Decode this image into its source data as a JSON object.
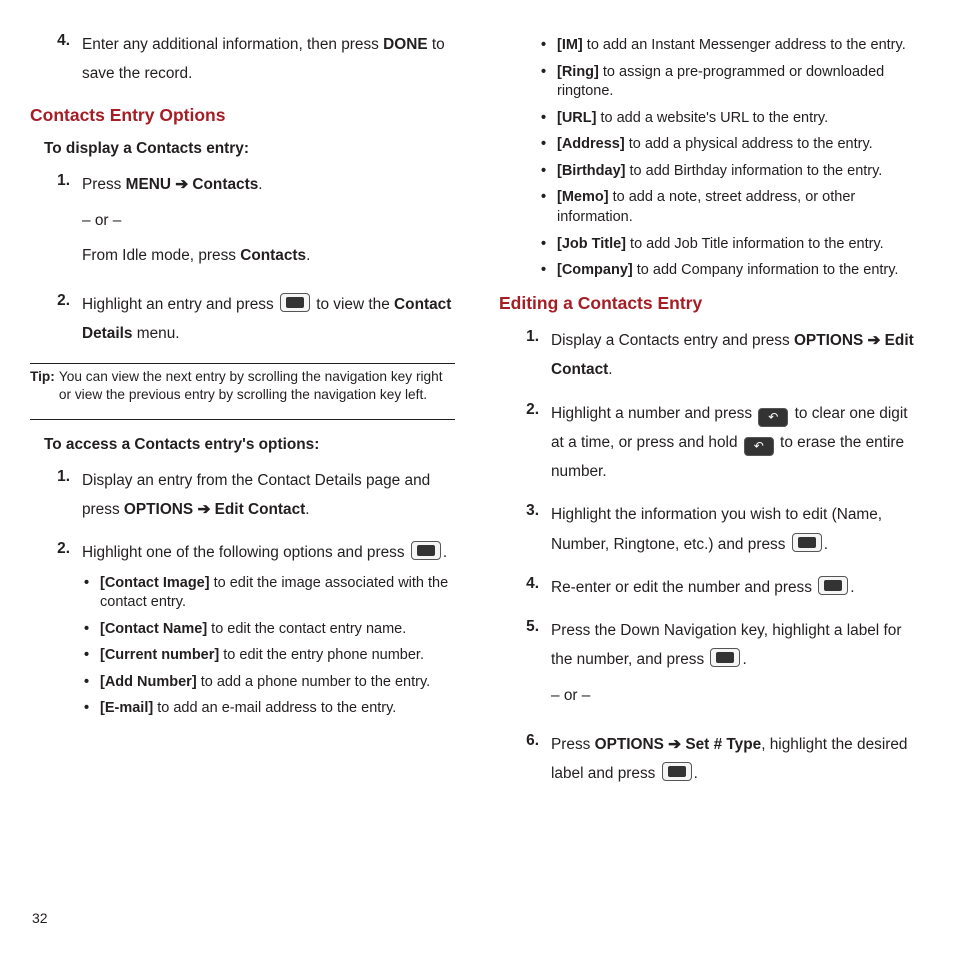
{
  "pageNumber": "32",
  "left": {
    "step4": {
      "num": "4.",
      "text_a": "Enter any additional information, then press ",
      "text_b": "DONE",
      "text_c": " to save the record."
    },
    "sectA_title": "Contacts Entry Options",
    "sectA_sub": "To display a Contacts entry:",
    "s1": {
      "num": "1.",
      "a": "Press ",
      "b": "MENU",
      "arrow": " ➔ ",
      "c": "Contacts",
      "d": ".",
      "or": "– or –",
      "e": "From Idle mode, press ",
      "f": "Contacts",
      "g": "."
    },
    "s2": {
      "num": "2.",
      "a": "Highlight an entry and press ",
      "b": " to view the ",
      "c": "Contact Details",
      "d": " menu."
    },
    "tip_label": "Tip:",
    "tip_text": " You can view the next entry by scrolling the navigation key right or view the previous entry by scrolling the navigation key left.",
    "sectB_sub": "To access a Contacts entry's options:",
    "b1": {
      "num": "1.",
      "a": "Display an entry from the Contact Details page and press ",
      "b": "OPTIONS",
      "arrow": " ➔ ",
      "c": "Edit Contact",
      "d": "."
    },
    "b2": {
      "num": "2.",
      "a": "Highlight one of the following options and press ",
      "dot": "."
    },
    "opts_left": [
      {
        "b": "[Contact Image]",
        "t": " to edit the image associated with the contact entry."
      },
      {
        "b": "[Contact Name]",
        "t": " to edit the contact entry name."
      },
      {
        "b": "[Current number]",
        "t": " to edit the entry phone number."
      },
      {
        "b": "[Add Number]",
        "t": " to add a phone number to the entry."
      },
      {
        "b": "[E-mail]",
        "t": " to add an e-mail address to the entry."
      }
    ]
  },
  "right": {
    "opts_right": [
      {
        "b": "[IM]",
        "t": " to add an Instant Messenger address to the entry."
      },
      {
        "b": "[Ring]",
        "t": " to assign a pre-programmed or downloaded ringtone."
      },
      {
        "b": "[URL]",
        "t": " to add a website's URL to the entry."
      },
      {
        "b": "[Address]",
        "t": " to add a physical address to the entry."
      },
      {
        "b": "[Birthday]",
        "t": " to add Birthday information to the entry."
      },
      {
        "b": "[Memo]",
        "t": " to add a note, street address, or other information."
      },
      {
        "b": "[Job Title]",
        "t": " to add Job Title information to the entry."
      },
      {
        "b": "[Company]",
        "t": " to add Company information to the entry."
      }
    ],
    "sectC_title": "Editing a Contacts Entry",
    "c1": {
      "num": "1.",
      "a": "Display a Contacts entry and press ",
      "b": "OPTIONS",
      "arrow": " ➔ ",
      "c": "Edit Contact",
      "d": "."
    },
    "c2": {
      "num": "2.",
      "a": "Highlight a number and press ",
      "b": " to clear one digit at a time, or press and hold ",
      "c": " to erase the entire number."
    },
    "c3": {
      "num": "3.",
      "a": "Highlight the information you wish to edit (Name, Number, Ringtone, etc.) and press ",
      "dot": "."
    },
    "c4": {
      "num": "4.",
      "a": "Re-enter or edit the number and press ",
      "dot": "."
    },
    "c5": {
      "num": "5.",
      "a": "Press the Down Navigation key, highlight a label for the number, and press ",
      "dot": ".",
      "or": "– or –"
    },
    "c6": {
      "num": "6.",
      "a": "Press ",
      "b": "OPTIONS",
      "arrow": "  ➔ ",
      "c": "Set # Type",
      "d": ", highlight the desired label and press ",
      "dot": "."
    }
  }
}
